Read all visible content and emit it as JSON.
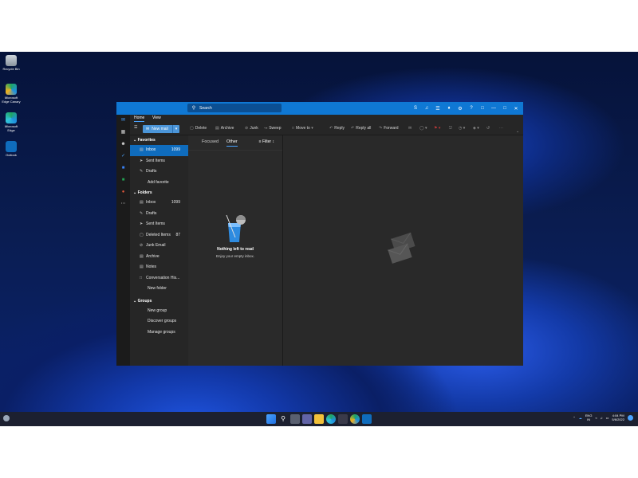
{
  "desktop": {
    "icons": [
      {
        "name": "recycle-bin-icon",
        "label": "Recycle Bin"
      },
      {
        "name": "edge-canary-icon",
        "label": "Microsoft Edge Canary"
      },
      {
        "name": "edge-icon",
        "label": "Microsoft Edge"
      },
      {
        "name": "outlook-desktop-icon",
        "label": "Outlook"
      }
    ]
  },
  "window": {
    "search_placeholder": "Search",
    "titlebar_icons": [
      "skype-icon",
      "megaphone-icon",
      "teams-icon",
      "bell-icon",
      "gear-icon",
      "help-icon",
      "gift-icon",
      "minimize-icon",
      "restore-icon",
      "close-icon"
    ],
    "ribbon_tabs": [
      "Home",
      "View"
    ],
    "toolbar": {
      "new_mail": "New mail",
      "delete": "Delete",
      "archive": "Archive",
      "junk": "Junk",
      "sweep": "Sweep",
      "move_to": "Move to",
      "reply": "Reply",
      "reply_all": "Reply all",
      "forward": "Forward"
    },
    "folders": {
      "favorites_label": "Favorites",
      "favorites": [
        {
          "label": "Inbox",
          "count": "1099",
          "icon": "inbox-icon"
        },
        {
          "label": "Sent Items",
          "count": "",
          "icon": "send-icon"
        },
        {
          "label": "Drafts",
          "count": "",
          "icon": "pencil-icon"
        }
      ],
      "add_favorite": "Add favorite",
      "folders_label": "Folders",
      "items": [
        {
          "label": "Inbox",
          "count": "1099",
          "icon": "inbox-icon"
        },
        {
          "label": "Drafts",
          "count": "",
          "icon": "pencil-icon"
        },
        {
          "label": "Sent Items",
          "count": "",
          "icon": "send-icon"
        },
        {
          "label": "Deleted Items",
          "count": "87",
          "icon": "trash-icon"
        },
        {
          "label": "Junk Email",
          "count": "",
          "icon": "junk-icon"
        },
        {
          "label": "Archive",
          "count": "",
          "icon": "archive-icon"
        },
        {
          "label": "Notes",
          "count": "",
          "icon": "note-icon"
        },
        {
          "label": "Conversation His...",
          "count": "",
          "icon": "folder-icon"
        }
      ],
      "new_folder": "New folder",
      "groups_label": "Groups",
      "new_group": "New group",
      "discover_groups": "Discover groups",
      "manage_groups": "Manage groups"
    },
    "list": {
      "tab_focused": "Focused",
      "tab_other": "Other",
      "filter": "Filter",
      "empty_title": "Nothing left to read",
      "empty_sub": "Enjoy your empty inbox."
    }
  },
  "taskbar": {
    "lang": "ENG",
    "region": "IN",
    "time": "4:04 PM",
    "date": "5/6/2022"
  },
  "colors": {
    "accent": "#0f78d4",
    "selection": "#0f6cbd"
  }
}
